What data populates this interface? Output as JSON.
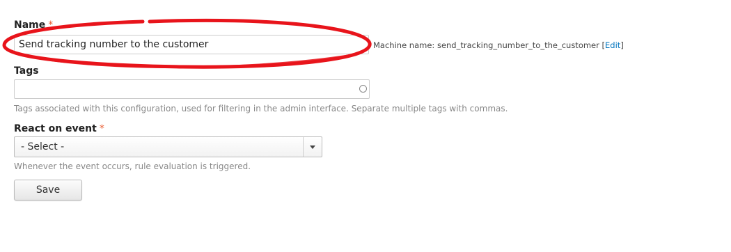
{
  "form": {
    "name": {
      "label": "Name",
      "required_marker": "*",
      "value": "Send tracking number to the customer"
    },
    "machine_name": {
      "prefix": "Machine name: ",
      "value": "send_tracking_number_to_the_customer",
      "bracket_open": " [",
      "edit_link": "Edit",
      "bracket_close": "]"
    },
    "tags": {
      "label": "Tags",
      "value": "",
      "description": "Tags associated with this configuration, used for filtering in the admin interface. Separate multiple tags with commas."
    },
    "event": {
      "label": "React on event",
      "required_marker": "*",
      "selected": "- Select -",
      "description": "Whenever the event occurs, rule evaluation is triggered."
    },
    "save_label": "Save"
  },
  "colors": {
    "required": "#e8572b",
    "link": "#0074bd",
    "annotation": "#e8141b",
    "description_text": "#888888"
  },
  "icons": {
    "tags_throbber": "autocomplete-throbber-icon",
    "select_arrow": "chevron-down-icon"
  }
}
